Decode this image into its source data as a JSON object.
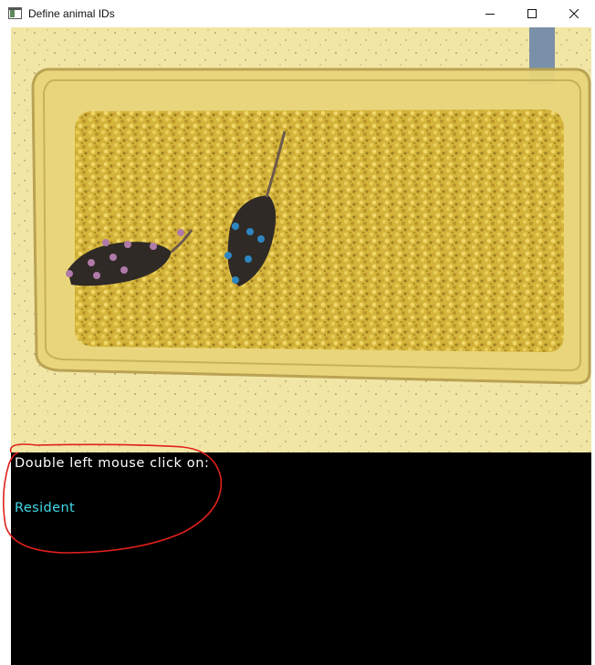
{
  "window": {
    "title": "Define animal IDs",
    "app_icon": "window-app-icon",
    "controls": {
      "minimize_icon": "minimize-icon",
      "maximize_icon": "maximize-icon",
      "close_icon": "close-icon"
    }
  },
  "video": {
    "description_icon": "video-frame",
    "pose_colors": {
      "animal_1": "#b07aa8",
      "animal_2": "#2e86c1"
    }
  },
  "console": {
    "instruction": "Double left mouse click on:",
    "animal_name": "Resident",
    "animal_name_color": "#41d9e8"
  },
  "annotation": {
    "color": "#e0201b"
  }
}
